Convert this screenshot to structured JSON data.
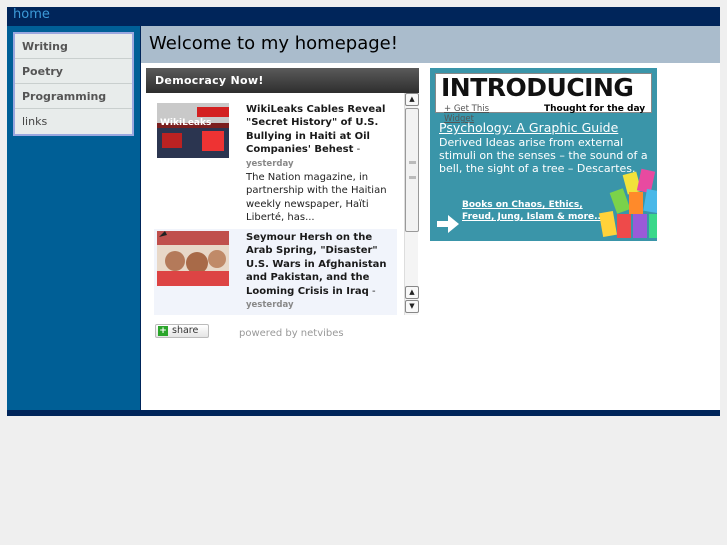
{
  "topbar": {
    "home_label": "home"
  },
  "sidebar": {
    "items": [
      {
        "label": "Writing"
      },
      {
        "label": "Poetry"
      },
      {
        "label": "Programming"
      },
      {
        "label": "links"
      }
    ]
  },
  "main": {
    "title": "Welcome to my homepage!"
  },
  "widget": {
    "header": "Democracy Now!",
    "items": [
      {
        "title": "WikiLeaks Cables Reveal \"Secret History\" of U.S. Bullying in Haiti at Oil Companies' Behest",
        "time": "yesterday",
        "summary": "The Nation magazine, in partnership with the Haitian weekly newspaper, Haïti Liberté, has...",
        "thumb_text": "WikiLeaks"
      },
      {
        "title": "Seymour Hersh on the Arab Spring, \"Disaster\" U.S. Wars in Afghanistan and Pakistan, and the Looming Crisis in Iraq",
        "time": "yesterday"
      }
    ],
    "share_label": "share",
    "powered_by": "powered by netvibes"
  },
  "quote": {
    "banner": "INTRODUCING",
    "get_widget": "+ Get This Widget",
    "thought": "Thought for the day",
    "title": "Psychology: A Graphic Guide",
    "text": "Derived Ideas arise from external stimuli on the senses – the sound of a bell, the sight of a tree – Descartes.",
    "books_link": "Books on Chaos, Ethics, Freud, Jung, Islam & more.."
  },
  "colors": {
    "frame": "#00255a",
    "sidebar": "#005f96",
    "titlebar": "#aabccc",
    "quote_bg": "#3a95a9"
  }
}
